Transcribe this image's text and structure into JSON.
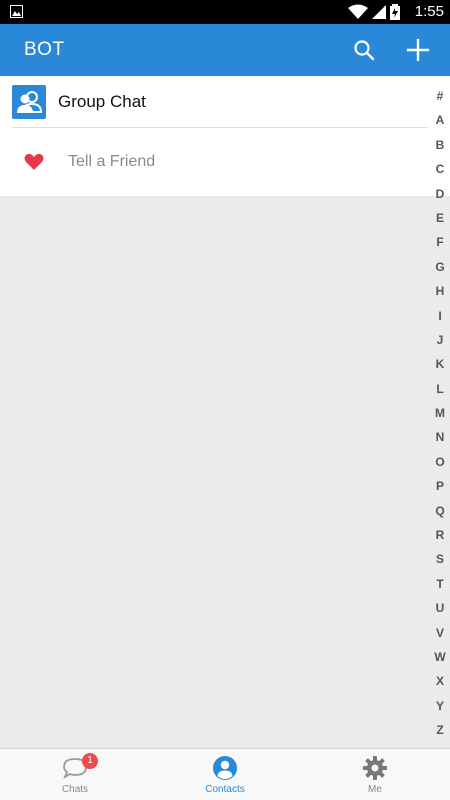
{
  "status_bar": {
    "time": "1:55"
  },
  "app_bar": {
    "title": "BOT"
  },
  "list": {
    "group_chat_label": "Group Chat",
    "tell_friend_label": "Tell a Friend"
  },
  "index_letters": [
    "#",
    "A",
    "B",
    "C",
    "D",
    "E",
    "F",
    "G",
    "H",
    "I",
    "J",
    "K",
    "L",
    "M",
    "N",
    "O",
    "P",
    "Q",
    "R",
    "S",
    "T",
    "U",
    "V",
    "W",
    "X",
    "Y",
    "Z"
  ],
  "bottom_nav": {
    "items": [
      {
        "label": "Chats",
        "badge": "1"
      },
      {
        "label": "Contacts"
      },
      {
        "label": "Me"
      }
    ],
    "active": "Contacts"
  },
  "colors": {
    "accent": "#2a88d8",
    "badge": "#f04a4a",
    "heart": "#e8394a"
  }
}
